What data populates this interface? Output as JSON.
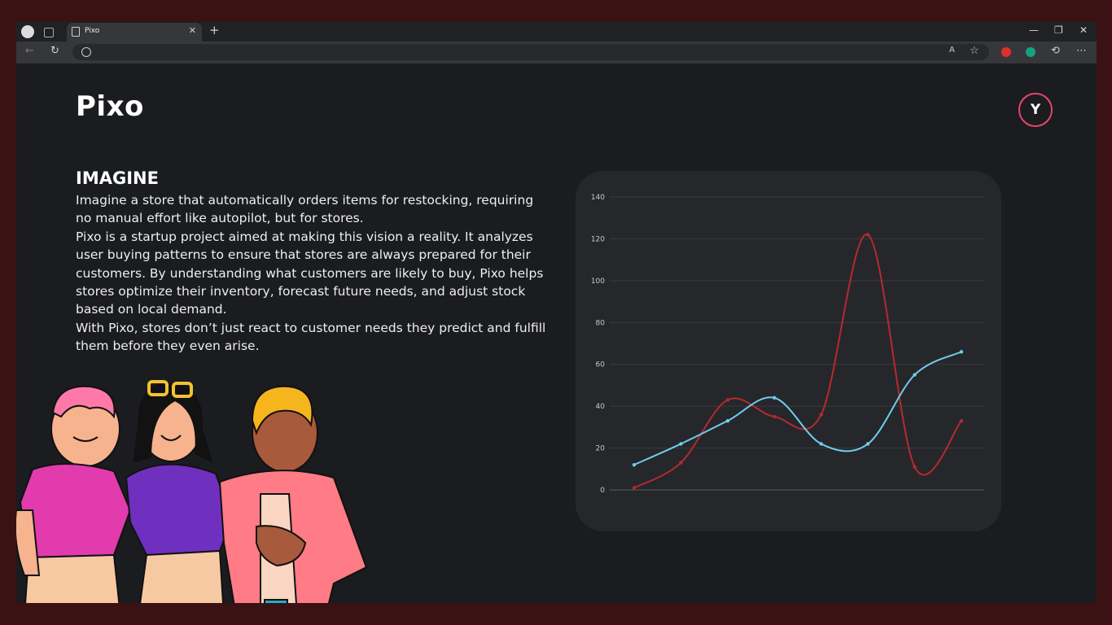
{
  "browser": {
    "tab_title": "Pixo",
    "new_tab_symbol": "+",
    "close_tab_symbol": "✕",
    "icons": [
      "profile-icon",
      "workspaces-icon",
      "page-icon",
      "back-icon",
      "reload-icon",
      "site-info-icon",
      "read-aloud-icon",
      "favorite-star-icon",
      "extension-icon",
      "grammarly-icon",
      "extensions-puzzle-icon",
      "more-menu-icon"
    ]
  },
  "header": {
    "brand": "Pixo",
    "avatar_initial": "Y",
    "avatar_border_color": "#e8456b"
  },
  "section": {
    "heading": "IMAGINE",
    "paragraph_1": "Imagine a store that automatically orders items for restocking, requiring no manual effort like autopilot, but for stores.",
    "paragraph_2": "Pixo is a startup project aimed at making this vision a reality. It analyzes user buying patterns to ensure that stores are always prepared for their customers. By understanding what customers are likely to buy, Pixo helps stores optimize their inventory, forecast future needs, and adjust stock based on local demand.",
    "paragraph_3": "With Pixo, stores don’t just react to customer needs they predict and fulfill them before they even arise."
  },
  "chart_data": {
    "type": "line",
    "title": "",
    "xlabel": "",
    "ylabel": "",
    "ylim": [
      0,
      140
    ],
    "yticks": [
      0,
      20,
      40,
      60,
      80,
      100,
      120,
      140
    ],
    "grid": true,
    "legend": "none",
    "x": [
      1,
      2,
      3,
      4,
      5,
      6,
      7,
      8
    ],
    "series": [
      {
        "color": "#b52a2e",
        "values": [
          1,
          13,
          43,
          35,
          36,
          122,
          11,
          33
        ]
      },
      {
        "color": "#6fcdf0",
        "values": [
          12,
          22,
          33,
          44,
          22,
          22,
          55,
          66
        ]
      }
    ]
  },
  "illustration": {
    "name": "three-friends-illustration"
  }
}
